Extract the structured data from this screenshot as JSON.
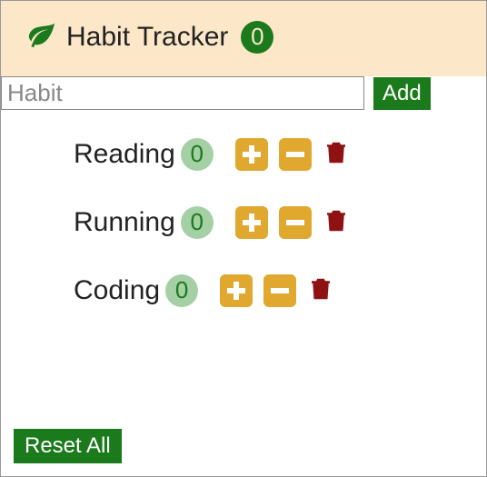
{
  "header": {
    "title": "Habit Tracker",
    "total_count": "0"
  },
  "input": {
    "placeholder": "Habit",
    "value": ""
  },
  "buttons": {
    "add": "Add",
    "reset": "Reset All"
  },
  "habits": [
    {
      "name": "Reading",
      "count": "0"
    },
    {
      "name": "Running",
      "count": "0"
    },
    {
      "name": "Coding",
      "count": "0"
    }
  ],
  "colors": {
    "accent": "#1b7a1b",
    "header_bg": "#fce8c9",
    "action_btn": "#e0a82f",
    "delete": "#8f1212",
    "badge_light": "#a5cfa5"
  }
}
